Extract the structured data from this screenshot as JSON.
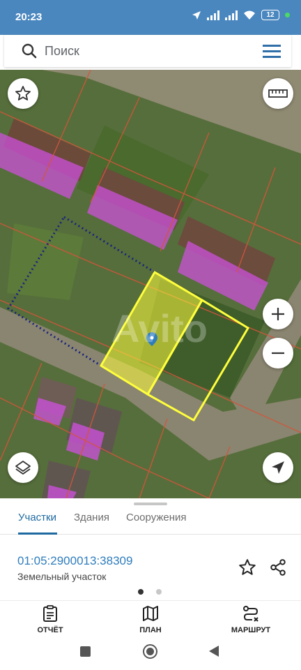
{
  "status_bar": {
    "time": "20:23",
    "battery": "12"
  },
  "search": {
    "placeholder": "Поиск"
  },
  "map": {
    "watermark": "Avito"
  },
  "sheet": {
    "tabs": [
      {
        "label": "Участки",
        "active": true
      },
      {
        "label": "Здания",
        "active": false
      },
      {
        "label": "Сооружения",
        "active": false
      }
    ],
    "cadastral_number": "01:05:2900013:38309",
    "parcel_type": "Земельный участок",
    "page_indicator": {
      "pages": 2,
      "active": 1
    }
  },
  "bottom_nav": {
    "items": [
      {
        "label": "ОТЧЁТ",
        "icon": "clipboard-icon"
      },
      {
        "label": "ПЛАН",
        "icon": "map-icon"
      },
      {
        "label": "МАРШРУТ",
        "icon": "route-icon"
      }
    ]
  },
  "colors": {
    "status_bar": "#4a87bf",
    "accent": "#1e6aa0",
    "link": "#2f7dbd",
    "parcel_highlight": "#ffff3c",
    "building_overlay": "#d050e0",
    "boundary_lines": "#d2553c",
    "dotted_boundary": "#1a237e"
  }
}
